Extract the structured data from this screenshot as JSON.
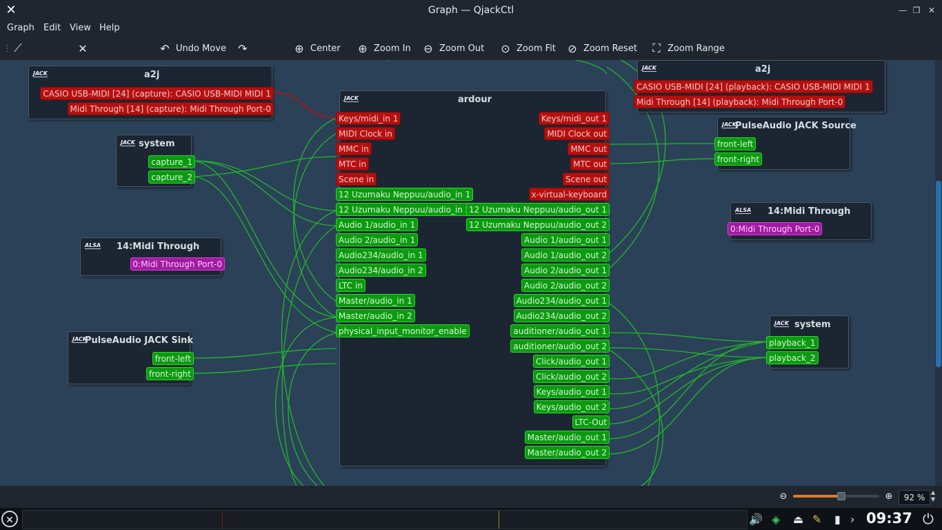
{
  "window": {
    "title": "Graph — QjackCtl",
    "app_icon": "qjackctl-icon",
    "controls": [
      "minimize-icon",
      "maximize-icon",
      "close-icon"
    ]
  },
  "menu": [
    "Graph",
    "Edit",
    "View",
    "Help"
  ],
  "toolbar": {
    "connect_icon": "connect-icon",
    "disconnect_icon": "disconnect-icon",
    "undo_label": "Undo Move",
    "center_label": "Center",
    "zoom_in_label": "Zoom In",
    "zoom_out_label": "Zoom Out",
    "zoom_fit_label": "Zoom Fit",
    "zoom_reset_label": "Zoom Reset",
    "zoom_range_label": "Zoom Range"
  },
  "nodes": {
    "a2j_left": {
      "tag": "JACK",
      "name": "a2j",
      "ports": [
        "CASIO USB-MIDI [24] (capture): CASIO USB-MIDI MIDI 1",
        "Midi Through [14] (capture): Midi Through Port-0"
      ]
    },
    "system_left": {
      "tag": "JACK",
      "name": "system",
      "ports": [
        "capture_1",
        "capture_2"
      ]
    },
    "midi_through_left": {
      "tag": "ALSA",
      "name": "14:Midi Through",
      "ports": [
        "0:Midi Through Port-0"
      ]
    },
    "pulse_sink": {
      "tag": "JACK",
      "name": "PulseAudio JACK Sink",
      "ports": [
        "front-left",
        "front-right"
      ]
    },
    "ardour": {
      "tag": "JACK",
      "name": "ardour",
      "inputs": [
        "Keys/midi_in 1",
        "MIDI Clock in",
        "MMC in",
        "MTC in",
        "Scene in",
        "12 Uzumaku Neppuu/audio_in 1",
        "12 Uzumaku Neppuu/audio_in 2",
        "Audio 1/audio_in 1",
        "Audio 2/audio_in 1",
        "Audio234/audio_in 1",
        "Audio234/audio_in 2",
        "LTC in",
        "Master/audio_in 1",
        "Master/audio_in 2",
        "physical_input_monitor_enable"
      ],
      "outputs": [
        "Keys/midi_out 1",
        "MIDI Clock out",
        "MMC out",
        "MTC out",
        "Scene out",
        "x-virtual-keyboard",
        "12 Uzumaku Neppuu/audio_out 1",
        "12 Uzumaku Neppuu/audio_out 2",
        "Audio 1/audio_out 1",
        "Audio 1/audio_out 2",
        "Audio 2/audio_out 1",
        "Audio 2/audio_out 2",
        "Audio234/audio_out 1",
        "Audio234/audio_out 2",
        "auditioner/audio_out 1",
        "auditioner/audio_out 2",
        "Click/audio_out 1",
        "Click/audio_out 2",
        "Keys/audio_out 1",
        "Keys/audio_out 2",
        "LTC-Out",
        "Master/audio_out 1",
        "Master/audio_out 2"
      ]
    },
    "a2j_right": {
      "tag": "JACK",
      "name": "a2j",
      "ports": [
        "CASIO USB-MIDI [24] (playback): CASIO USB-MIDI MIDI 1",
        "Midi Through [14] (playback): Midi Through Port-0"
      ]
    },
    "pulse_source": {
      "tag": "JACK",
      "name": "PulseAudio JACK Source",
      "ports": [
        "front-left",
        "front-right"
      ]
    },
    "midi_through_right": {
      "tag": "ALSA",
      "name": "14:Midi Through",
      "ports": [
        "0:Midi Through Port-0"
      ]
    },
    "system_right": {
      "tag": "JACK",
      "name": "system",
      "ports": [
        "playback_1",
        "playback_2"
      ]
    }
  },
  "colors": {
    "midi": "#b5100f",
    "audio": "#0c9a10",
    "alsa": "#a21aa2",
    "wire_audio": "#22c425",
    "wire_midi": "#c01010"
  },
  "status": {
    "zoom_percent": "92 %",
    "zoom_level": 0.55
  },
  "taskbar": {
    "clock": "09:37"
  }
}
